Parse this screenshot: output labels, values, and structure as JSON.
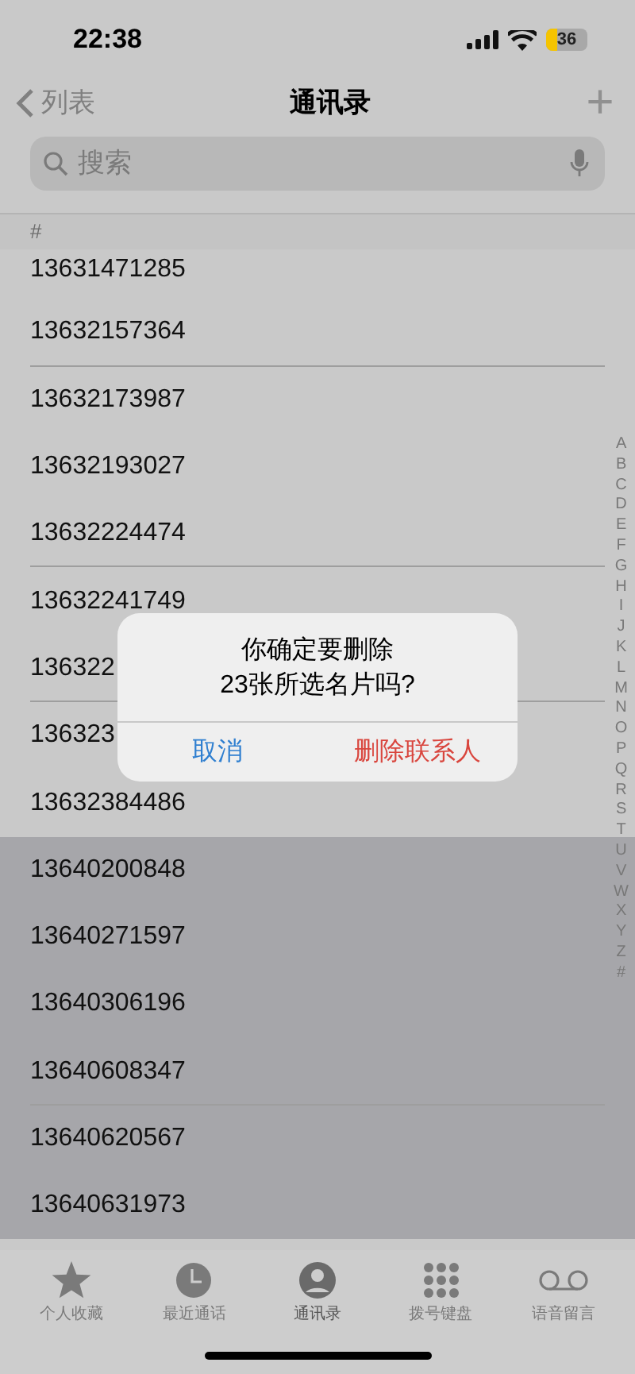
{
  "status_bar": {
    "time": "22:38",
    "battery": "36"
  },
  "nav": {
    "back": "列表",
    "title": "通讯录",
    "add": "+"
  },
  "search": {
    "placeholder": "搜索"
  },
  "section": {
    "header": "#"
  },
  "rows": [
    {
      "text": "13631471285",
      "selected": false,
      "divider_below": false
    },
    {
      "text": "13632157364",
      "selected": false,
      "divider_below": true
    },
    {
      "text": "13632173987",
      "selected": false,
      "divider_below": false
    },
    {
      "text": "13632193027",
      "selected": false,
      "divider_below": false
    },
    {
      "text": "13632224474",
      "selected": false,
      "divider_below": true
    },
    {
      "text": "13632241749",
      "selected": false,
      "divider_below": false
    },
    {
      "text": "136322",
      "selected": false,
      "divider_below": true
    },
    {
      "text": "136323",
      "selected": false,
      "divider_below": false
    },
    {
      "text": "13632384486",
      "selected": false,
      "divider_below": false
    },
    {
      "text": "13640200848",
      "selected": true,
      "divider_below": false
    },
    {
      "text": "13640271597",
      "selected": true,
      "divider_below": false
    },
    {
      "text": "13640306196",
      "selected": true,
      "divider_below": false
    },
    {
      "text": "13640608347",
      "selected": true,
      "divider_below": true
    },
    {
      "text": "13640620567",
      "selected": true,
      "divider_below": false
    },
    {
      "text": "13640631973",
      "selected": true,
      "divider_below": false
    }
  ],
  "index": [
    "A",
    "B",
    "C",
    "D",
    "E",
    "F",
    "G",
    "H",
    "I",
    "J",
    "K",
    "L",
    "M",
    "N",
    "O",
    "P",
    "Q",
    "R",
    "S",
    "T",
    "U",
    "V",
    "W",
    "X",
    "Y",
    "Z",
    "#"
  ],
  "alert": {
    "message": "你确定要删除\n23张所选名片吗?",
    "buttons": [
      {
        "label": "取消",
        "kind": "cancel"
      },
      {
        "label": "删除联系人",
        "kind": "destructive"
      }
    ]
  },
  "tab_bar": [
    {
      "label": "个人收藏",
      "kind": "star",
      "selected": false
    },
    {
      "label": "最近通话",
      "kind": "clock",
      "selected": false
    },
    {
      "label": "通讯录",
      "kind": "person",
      "selected": true
    },
    {
      "label": "拨号键盘",
      "kind": "keypad",
      "selected": false
    },
    {
      "label": "语音留言",
      "kind": "voicemail",
      "selected": false
    }
  ]
}
